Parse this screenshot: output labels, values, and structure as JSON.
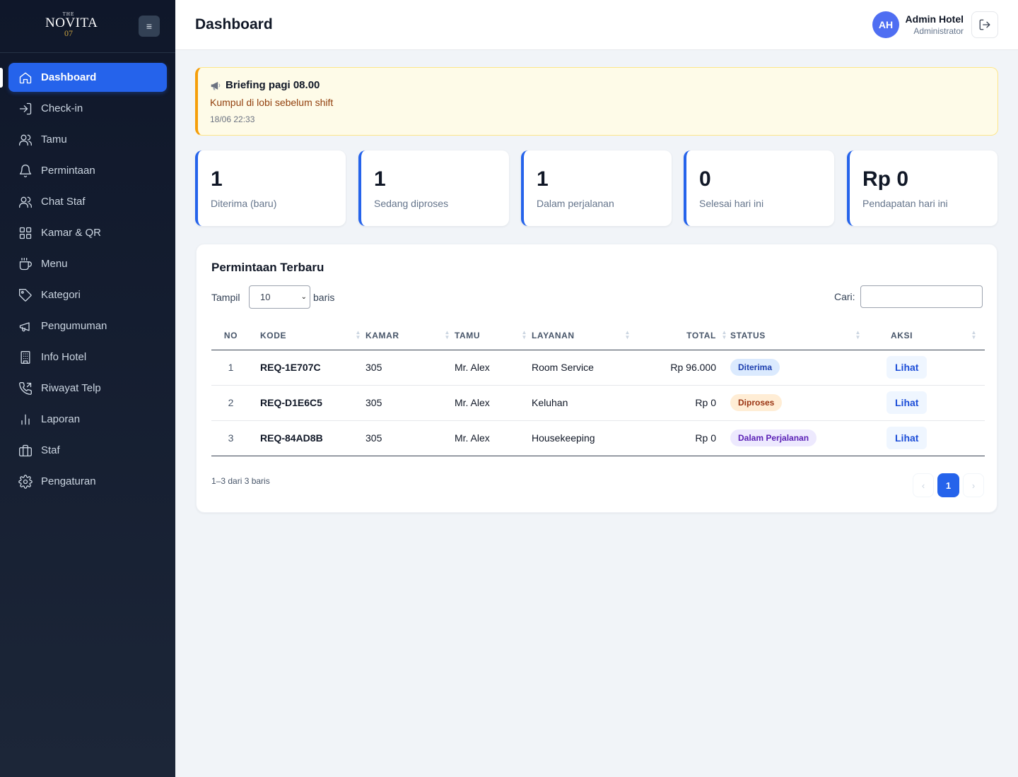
{
  "brand": {
    "line1": "THE",
    "line2": "NOVITA",
    "line3": "07",
    "burger": "≡"
  },
  "sidebar": {
    "items": [
      {
        "label": "Dashboard",
        "icon": "home-icon"
      },
      {
        "label": "Check-in",
        "icon": "login-icon"
      },
      {
        "label": "Tamu",
        "icon": "users-icon"
      },
      {
        "label": "Permintaan",
        "icon": "bell-icon"
      },
      {
        "label": "Chat Staf",
        "icon": "users-icon"
      },
      {
        "label": "Kamar & QR",
        "icon": "grid-icon"
      },
      {
        "label": "Menu",
        "icon": "coffee-icon"
      },
      {
        "label": "Kategori",
        "icon": "tag-icon"
      },
      {
        "label": "Pengumuman",
        "icon": "megaphone-icon"
      },
      {
        "label": "Info Hotel",
        "icon": "building-icon"
      },
      {
        "label": "Riwayat Telp",
        "icon": "phone-icon"
      },
      {
        "label": "Laporan",
        "icon": "bar-chart-icon"
      },
      {
        "label": "Staf",
        "icon": "briefcase-icon"
      },
      {
        "label": "Pengaturan",
        "icon": "gear-icon"
      }
    ]
  },
  "header": {
    "title": "Dashboard",
    "avatar_initials": "AH",
    "user_name": "Admin Hotel",
    "user_role": "Administrator"
  },
  "announcement": {
    "title": "Briefing pagi 08.00",
    "body": "Kumpul di lobi sebelum shift",
    "time": "18/06 22:33"
  },
  "stats": [
    {
      "value": "1",
      "label": "Diterima (baru)"
    },
    {
      "value": "1",
      "label": "Sedang diproses"
    },
    {
      "value": "1",
      "label": "Dalam perjalanan"
    },
    {
      "value": "0",
      "label": "Selesai hari ini"
    },
    {
      "value": "Rp 0",
      "label": "Pendapatan hari ini"
    }
  ],
  "requests": {
    "title": "Permintaan Terbaru",
    "length_label": "Tampil",
    "length_value": "10",
    "length_suffix": "baris",
    "search_label": "Cari:",
    "columns": [
      "NO",
      "KODE",
      "KAMAR",
      "TAMU",
      "LAYANAN",
      "TOTAL",
      "STATUS",
      "AKSI"
    ],
    "rows": [
      {
        "no": "1",
        "kode": "REQ-1E707C",
        "kamar": "305",
        "tamu": "Mr. Alex",
        "layanan": "Room Service",
        "total": "Rp 96.000",
        "status": "Diterima",
        "aksi": "Lihat"
      },
      {
        "no": "2",
        "kode": "REQ-D1E6C5",
        "kamar": "305",
        "tamu": "Mr. Alex",
        "layanan": "Keluhan",
        "total": "Rp 0",
        "status": "Diproses",
        "aksi": "Lihat"
      },
      {
        "no": "3",
        "kode": "REQ-84AD8B",
        "kamar": "305",
        "tamu": "Mr. Alex",
        "layanan": "Housekeeping",
        "total": "Rp 0",
        "status": "Dalam Perjalanan",
        "aksi": "Lihat"
      }
    ],
    "info": "1–3 dari 3 baris",
    "pager": {
      "prev": "‹",
      "current": "1",
      "next": "›"
    }
  },
  "colors": {
    "accent": "#2563eb",
    "sidebar": "#0f172a",
    "announce_border": "#f59e0b"
  }
}
